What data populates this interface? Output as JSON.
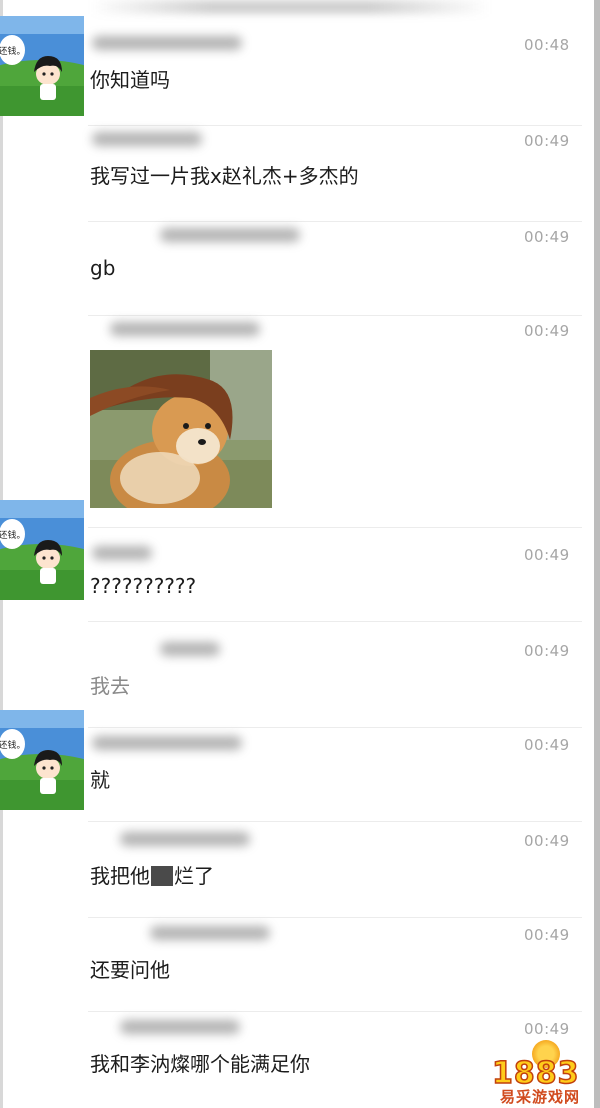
{
  "messages": [
    {
      "time": "00:48",
      "text": "你知道吗"
    },
    {
      "time": "00:49",
      "text": "我写过一片我x赵礼杰+多杰的"
    },
    {
      "time": "00:49",
      "text": "gb"
    },
    {
      "time": "00:49",
      "text": ""
    },
    {
      "time": "00:49",
      "text": "??????????"
    },
    {
      "time": "00:49",
      "text": "我去"
    },
    {
      "time": "00:49",
      "text": "就"
    },
    {
      "time": "00:49",
      "text_before": "我把他",
      "text_after": "烂了"
    },
    {
      "time": "00:49",
      "text": "还要问他"
    },
    {
      "time": "00:49",
      "text": "我和李汭燦哪个能满足你"
    }
  ],
  "avatar": {
    "bubble_text": "还钱。"
  },
  "watermark": {
    "logo": "1883",
    "subtitle": "易采游戏网"
  }
}
